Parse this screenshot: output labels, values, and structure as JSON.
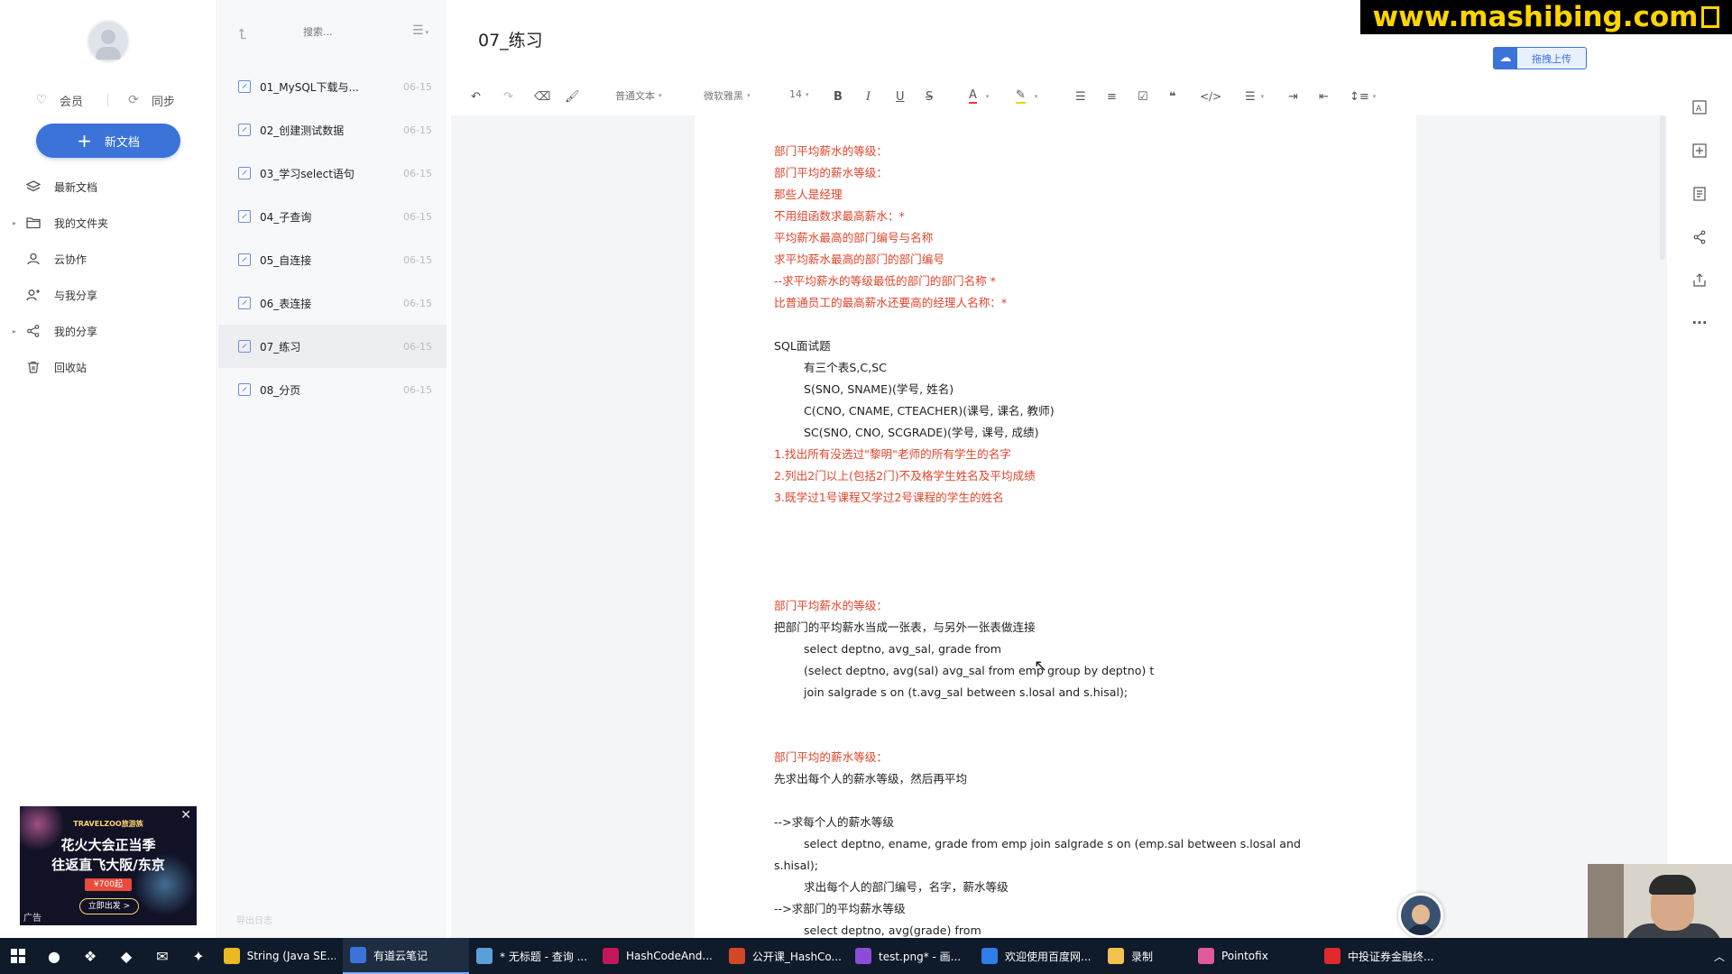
{
  "sidebar": {
    "member_label": "会员",
    "sync_label": "同步",
    "new_doc_label": "新文档",
    "nav": [
      {
        "label": "最新文档",
        "icon": "layers-icon",
        "expandable": false
      },
      {
        "label": "我的文件夹",
        "icon": "folder-icon",
        "expandable": true
      },
      {
        "label": "云协作",
        "icon": "user-icon",
        "expandable": false
      },
      {
        "label": "与我分享",
        "icon": "users-icon",
        "expandable": false
      },
      {
        "label": "我的分享",
        "icon": "share-icon",
        "expandable": true
      },
      {
        "label": "回收站",
        "icon": "trash-icon",
        "expandable": false
      }
    ],
    "ad": {
      "brand": "TRAVELZOO旅游族",
      "line1": "花火大会正当季",
      "line2": "往返直飞大阪/东京",
      "price": "¥700起",
      "cta": "立即出发 >",
      "tag": "广告"
    }
  },
  "doclist": {
    "search_placeholder": "搜索...",
    "footer": "导出日志",
    "items": [
      {
        "title": "01_MySQL下载与...",
        "date": "06-15",
        "active": false
      },
      {
        "title": "02_创建测试数据",
        "date": "06-15",
        "active": false
      },
      {
        "title": "03_学习select语句",
        "date": "06-15",
        "active": false
      },
      {
        "title": "04_子查询",
        "date": "06-15",
        "active": false
      },
      {
        "title": "05_自连接",
        "date": "06-15",
        "active": false
      },
      {
        "title": "06_表连接",
        "date": "06-15",
        "active": false
      },
      {
        "title": "07_练习",
        "date": "06-15",
        "active": true
      },
      {
        "title": "08_分页",
        "date": "06-15",
        "active": false
      }
    ]
  },
  "header": {
    "doc_title": "07_练习",
    "watermark": "www.mashibing.com",
    "upload_label": "拖拽上传"
  },
  "toolbar": {
    "paragraph_style": "普通文本",
    "font_family": "微软雅黑",
    "font_size": "14"
  },
  "editor": {
    "lines": [
      {
        "text": "部门平均薪水的等级：",
        "color": "red",
        "indent": false
      },
      {
        "text": "部门平均的薪水等级：",
        "color": "red",
        "indent": false
      },
      {
        "text": "那些人是经理",
        "color": "red",
        "indent": false
      },
      {
        "text": "不用组函数求最高薪水：*",
        "color": "red",
        "indent": false
      },
      {
        "text": "平均薪水最高的部门编号与名称",
        "color": "red",
        "indent": false
      },
      {
        "text": "求平均薪水最高的部门的部门编号",
        "color": "red",
        "indent": false
      },
      {
        "text": "--求平均薪水的等级最低的部门的部门名称 *",
        "color": "red",
        "indent": false
      },
      {
        "text": "比普通员工的最高薪水还要高的经理人名称：*",
        "color": "red",
        "indent": false
      },
      {
        "text": "",
        "color": "black",
        "indent": false
      },
      {
        "text": "SQL面试题",
        "color": "black",
        "indent": false
      },
      {
        "text": "有三个表S,C,SC",
        "color": "black",
        "indent": true
      },
      {
        "text": "S(SNO, SNAME)(学号, 姓名)",
        "color": "black",
        "indent": true
      },
      {
        "text": "C(CNO, CNAME, CTEACHER)(课号, 课名, 教师)",
        "color": "black",
        "indent": true
      },
      {
        "text": "SC(SNO, CNO, SCGRADE)(学号, 课号, 成绩)",
        "color": "black",
        "indent": true
      },
      {
        "text": "1.找出所有没选过\"黎明\"老师的所有学生的名字",
        "color": "red",
        "indent": false
      },
      {
        "text": "2.列出2门以上(包括2门)不及格学生姓名及平均成绩",
        "color": "red",
        "indent": false
      },
      {
        "text": "3.既学过1号课程又学过2号课程的学生的姓名",
        "color": "red",
        "indent": false
      },
      {
        "text": "",
        "color": "black",
        "indent": false
      },
      {
        "text": "",
        "color": "black",
        "indent": false
      },
      {
        "text": "",
        "color": "black",
        "indent": false
      },
      {
        "text": "",
        "color": "black",
        "indent": false
      },
      {
        "text": "部门平均薪水的等级：",
        "color": "red",
        "indent": false
      },
      {
        "text": "把部门的平均薪水当成一张表，与另外一张表做连接",
        "color": "black",
        "indent": false
      },
      {
        "text": "select deptno, avg_sal, grade from",
        "color": "black",
        "indent": true
      },
      {
        "text": "(select deptno, avg(sal) avg_sal from emp group by deptno) t",
        "color": "black",
        "indent": true
      },
      {
        "text": "join salgrade s on (t.avg_sal between s.losal and s.hisal);",
        "color": "black",
        "indent": true
      },
      {
        "text": "",
        "color": "black",
        "indent": false
      },
      {
        "text": "",
        "color": "black",
        "indent": false
      },
      {
        "text": "部门平均的薪水等级：",
        "color": "red",
        "indent": false
      },
      {
        "text": "先求出每个人的薪水等级，然后再平均",
        "color": "black",
        "indent": false
      },
      {
        "text": "",
        "color": "black",
        "indent": false
      },
      {
        "text": "-->求每个人的薪水等级",
        "color": "black",
        "indent": false
      },
      {
        "text": "select deptno, ename, grade from emp join salgrade s on (emp.sal between s.losal and",
        "color": "black",
        "indent": true
      },
      {
        "text": "s.hisal);",
        "color": "black",
        "indent": false
      },
      {
        "text": "求出每个人的部门编号，名字，薪水等级",
        "color": "black",
        "indent": true
      },
      {
        "text": "-->求部门的平均薪水等级",
        "color": "black",
        "indent": false
      },
      {
        "text": "select deptno, avg(grade) from",
        "color": "black",
        "indent": true
      }
    ]
  },
  "taskbar": {
    "tasks": [
      {
        "label": "String (Java SE...",
        "icon": "chrome-icon",
        "color": "#e8b923",
        "active": false
      },
      {
        "label": "有道云笔记",
        "icon": "notes-icon",
        "color": "#3b73d9",
        "active": true
      },
      {
        "label": "* 无标题 - 查询 ...",
        "icon": "navicat-icon",
        "color": "#5aa0d8",
        "active": false
      },
      {
        "label": "HashCodeAnd...",
        "icon": "idea-icon",
        "color": "#c2185b",
        "active": false
      },
      {
        "label": "公开课_HashCo...",
        "icon": "ppt-icon",
        "color": "#d24726",
        "active": false
      },
      {
        "label": "test.png* - 画...",
        "icon": "paint-icon",
        "color": "#8a4dd8",
        "active": false
      },
      {
        "label": "欢迎使用百度网...",
        "icon": "baidu-icon",
        "color": "#2f7dea",
        "active": false
      },
      {
        "label": "录制",
        "icon": "folder-icon",
        "color": "#f2c14e",
        "active": false
      },
      {
        "label": "Pointofix",
        "icon": "pointofix-icon",
        "color": "#e05a9b",
        "active": false
      },
      {
        "label": "中投证券金融终...",
        "icon": "stock-icon",
        "color": "#e02a2a",
        "active": false
      }
    ]
  }
}
